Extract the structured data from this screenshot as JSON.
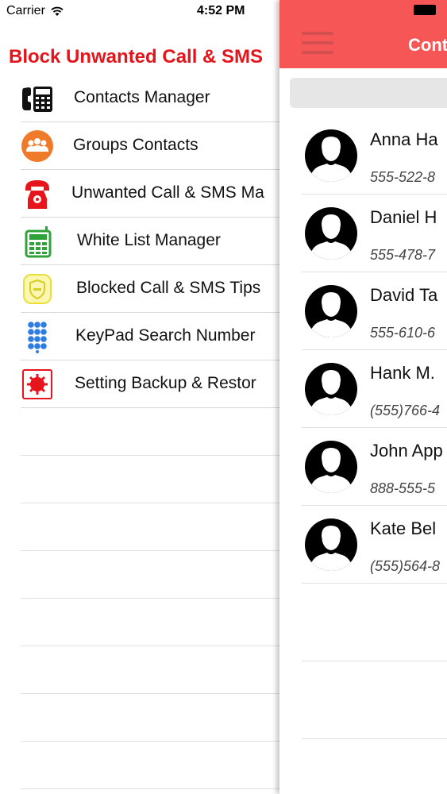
{
  "status_bar": {
    "carrier": "Carrier",
    "time": "4:52 PM"
  },
  "menu": {
    "title": "Block Unwanted Call & SMS",
    "items": [
      {
        "label": "Contacts Manager",
        "icon": "office-phone-icon"
      },
      {
        "label": "Groups Contacts",
        "icon": "group-people-icon"
      },
      {
        "label": "Unwanted Call & SMS Ma",
        "icon": "red-telephone-icon"
      },
      {
        "label": "White List Manager",
        "icon": "green-phone-keypad-icon"
      },
      {
        "label": "Blocked Call & SMS Tips",
        "icon": "yellow-shield-icon"
      },
      {
        "label": "KeyPad Search Number",
        "icon": "blue-keypad-icon"
      },
      {
        "label": "Setting Backup & Restor",
        "icon": "red-settings-box-icon"
      }
    ]
  },
  "panel": {
    "header_title": "Cont",
    "accent": "#f65656",
    "contacts": [
      {
        "name": "Anna Ha",
        "phone": "555-522-8"
      },
      {
        "name": "Daniel H",
        "phone": "555-478-7"
      },
      {
        "name": "David Ta",
        "phone": "555-610-6"
      },
      {
        "name": "Hank M.",
        "phone": "(555)766-4"
      },
      {
        "name": "John App",
        "phone": "888-555-5"
      },
      {
        "name": "Kate Bel",
        "phone": "(555)564-8"
      }
    ]
  }
}
